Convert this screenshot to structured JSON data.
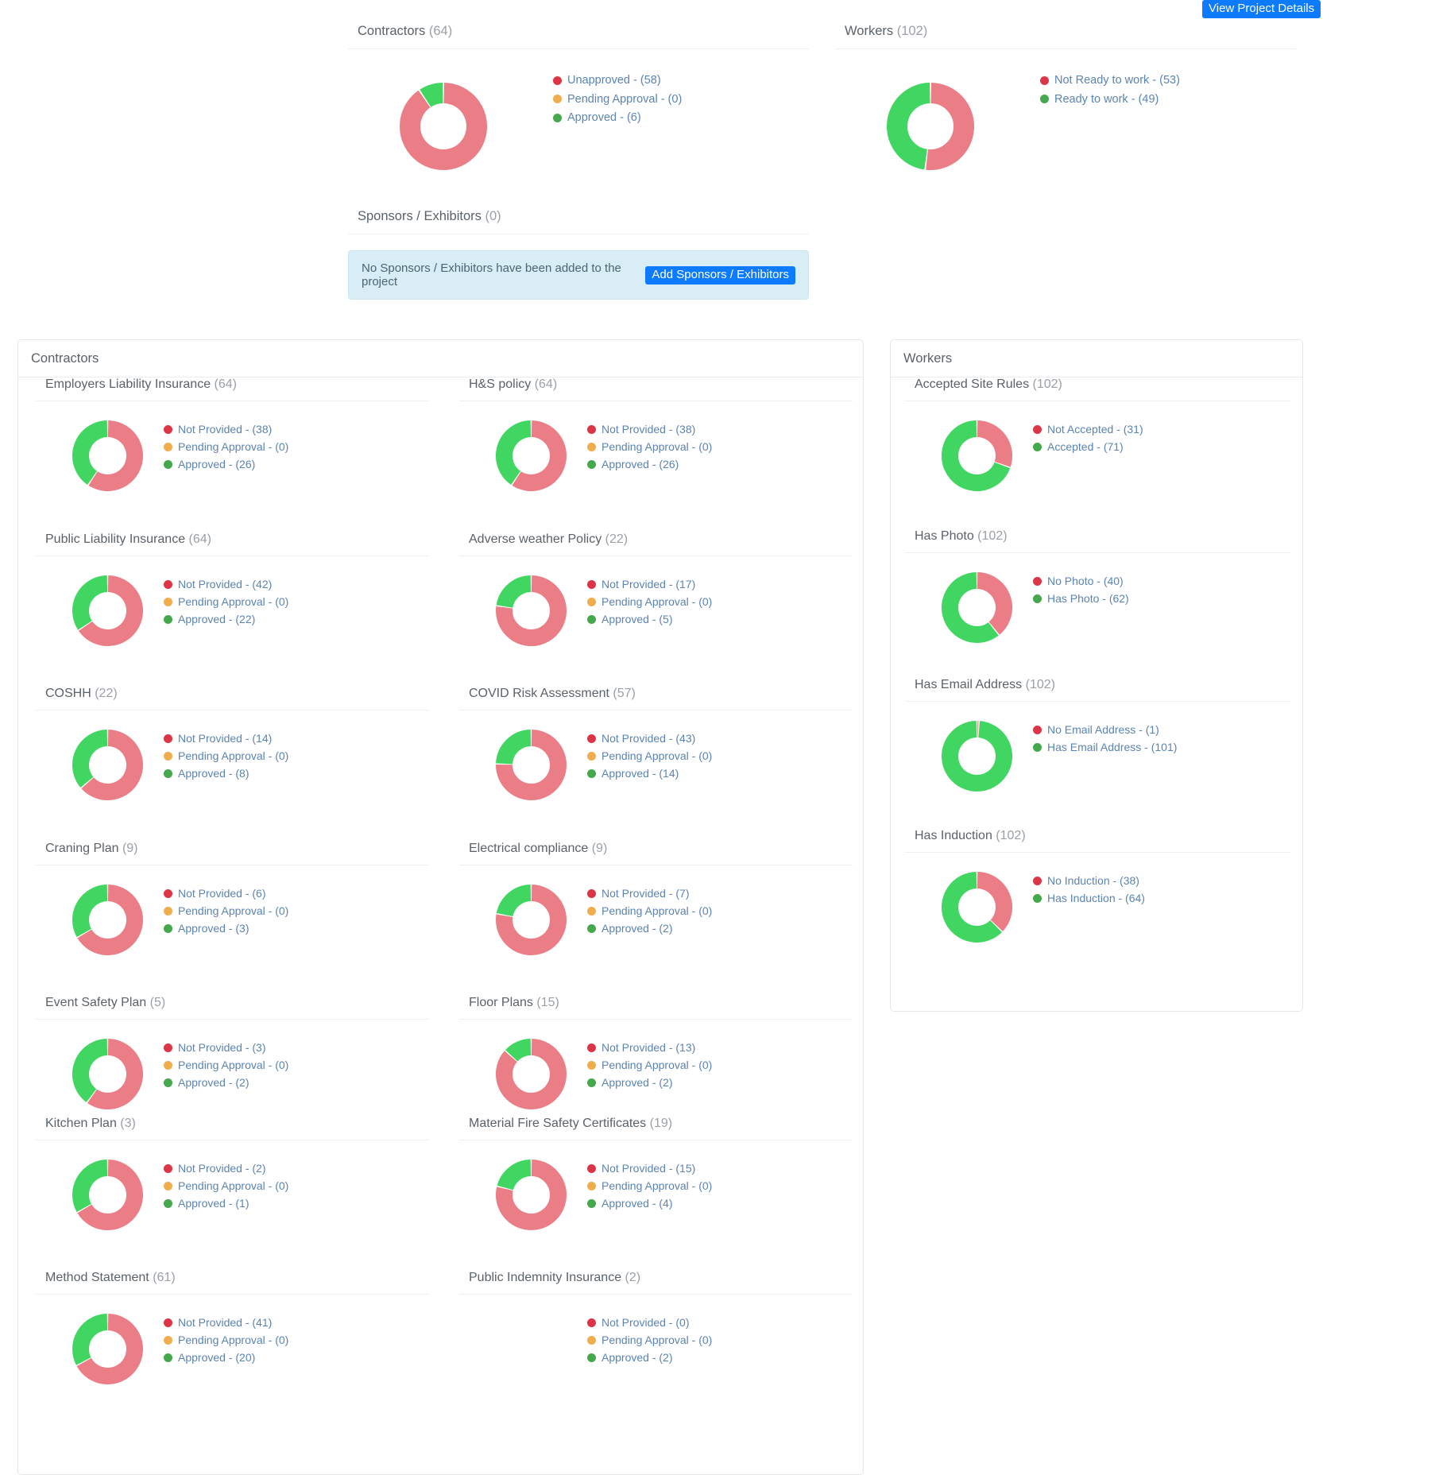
{
  "topbar": {
    "view_project_details": "View Project Details"
  },
  "colors": {
    "donut_red": "#ea7d86",
    "donut_green": "#41d661",
    "legend_red": "#dc3545",
    "legend_orange": "#f0ad4e",
    "legend_green": "#46a84c",
    "legend_text": "#5b84b1",
    "accent_blue": "#0d7bff",
    "alert_bg": "#d9edf7"
  },
  "summary": {
    "contractors": {
      "title": "Contractors",
      "count": "(64)",
      "legend": [
        {
          "label": "Unapproved - (58)",
          "color_key": "legend_red",
          "value": 58
        },
        {
          "label": "Pending Approval - (0)",
          "color_key": "legend_orange",
          "value": 0
        },
        {
          "label": "Approved - (6)",
          "color_key": "legend_green",
          "value": 6
        }
      ]
    },
    "workers": {
      "title": "Workers",
      "count": "(102)",
      "legend": [
        {
          "label": "Not Ready to work - (53)",
          "color_key": "legend_red",
          "value": 53
        },
        {
          "label": "Ready to work - (49)",
          "color_key": "legend_green",
          "value": 49
        }
      ]
    },
    "sponsors": {
      "title": "Sponsors / Exhibitors",
      "count": "(0)",
      "empty_message": "No Sponsors / Exhibitors have been added to the project",
      "add_button": "Add Sponsors / Exhibitors"
    }
  },
  "contractors_panel": {
    "title": "Contractors",
    "metrics": [
      {
        "title": "Employers Liability Insurance",
        "count": "(64)",
        "legend": [
          {
            "label": "Not Provided - (38)",
            "color_key": "legend_red",
            "value": 38
          },
          {
            "label": "Pending Approval - (0)",
            "color_key": "legend_orange",
            "value": 0
          },
          {
            "label": "Approved - (26)",
            "color_key": "legend_green",
            "value": 26
          }
        ]
      },
      {
        "title": "H&S policy",
        "count": "(64)",
        "legend": [
          {
            "label": "Not Provided - (38)",
            "color_key": "legend_red",
            "value": 38
          },
          {
            "label": "Pending Approval - (0)",
            "color_key": "legend_orange",
            "value": 0
          },
          {
            "label": "Approved - (26)",
            "color_key": "legend_green",
            "value": 26
          }
        ]
      },
      {
        "title": "Public Liability Insurance",
        "count": "(64)",
        "legend": [
          {
            "label": "Not Provided - (42)",
            "color_key": "legend_red",
            "value": 42
          },
          {
            "label": "Pending Approval - (0)",
            "color_key": "legend_orange",
            "value": 0
          },
          {
            "label": "Approved - (22)",
            "color_key": "legend_green",
            "value": 22
          }
        ]
      },
      {
        "title": "Adverse weather Policy",
        "count": "(22)",
        "legend": [
          {
            "label": "Not Provided - (17)",
            "color_key": "legend_red",
            "value": 17
          },
          {
            "label": "Pending Approval - (0)",
            "color_key": "legend_orange",
            "value": 0
          },
          {
            "label": "Approved - (5)",
            "color_key": "legend_green",
            "value": 5
          }
        ]
      },
      {
        "title": "COSHH",
        "count": "(22)",
        "legend": [
          {
            "label": "Not Provided - (14)",
            "color_key": "legend_red",
            "value": 14
          },
          {
            "label": "Pending Approval - (0)",
            "color_key": "legend_orange",
            "value": 0
          },
          {
            "label": "Approved - (8)",
            "color_key": "legend_green",
            "value": 8
          }
        ]
      },
      {
        "title": "COVID Risk Assessment",
        "count": "(57)",
        "legend": [
          {
            "label": "Not Provided - (43)",
            "color_key": "legend_red",
            "value": 43
          },
          {
            "label": "Pending Approval - (0)",
            "color_key": "legend_orange",
            "value": 0
          },
          {
            "label": "Approved - (14)",
            "color_key": "legend_green",
            "value": 14
          }
        ]
      },
      {
        "title": "Craning Plan",
        "count": "(9)",
        "legend": [
          {
            "label": "Not Provided - (6)",
            "color_key": "legend_red",
            "value": 6
          },
          {
            "label": "Pending Approval - (0)",
            "color_key": "legend_orange",
            "value": 0
          },
          {
            "label": "Approved - (3)",
            "color_key": "legend_green",
            "value": 3
          }
        ]
      },
      {
        "title": "Electrical compliance",
        "count": "(9)",
        "legend": [
          {
            "label": "Not Provided - (7)",
            "color_key": "legend_red",
            "value": 7
          },
          {
            "label": "Pending Approval - (0)",
            "color_key": "legend_orange",
            "value": 0
          },
          {
            "label": "Approved - (2)",
            "color_key": "legend_green",
            "value": 2
          }
        ]
      },
      {
        "title": "Event Safety Plan",
        "count": "(5)",
        "legend": [
          {
            "label": "Not Provided - (3)",
            "color_key": "legend_red",
            "value": 3
          },
          {
            "label": "Pending Approval - (0)",
            "color_key": "legend_orange",
            "value": 0
          },
          {
            "label": "Approved - (2)",
            "color_key": "legend_green",
            "value": 2
          }
        ]
      },
      {
        "title": "Floor Plans",
        "count": "(15)",
        "legend": [
          {
            "label": "Not Provided - (13)",
            "color_key": "legend_red",
            "value": 13
          },
          {
            "label": "Pending Approval - (0)",
            "color_key": "legend_orange",
            "value": 0
          },
          {
            "label": "Approved - (2)",
            "color_key": "legend_green",
            "value": 2
          }
        ]
      },
      {
        "title": "Kitchen Plan",
        "count": "(3)",
        "legend": [
          {
            "label": "Not Provided - (2)",
            "color_key": "legend_red",
            "value": 2
          },
          {
            "label": "Pending Approval - (0)",
            "color_key": "legend_orange",
            "value": 0
          },
          {
            "label": "Approved - (1)",
            "color_key": "legend_green",
            "value": 1
          }
        ]
      },
      {
        "title": "Material Fire Safety Certificates",
        "count": "(19)",
        "legend": [
          {
            "label": "Not Provided - (15)",
            "color_key": "legend_red",
            "value": 15
          },
          {
            "label": "Pending Approval - (0)",
            "color_key": "legend_orange",
            "value": 0
          },
          {
            "label": "Approved - (4)",
            "color_key": "legend_green",
            "value": 4
          }
        ]
      },
      {
        "title": "Method Statement",
        "count": "(61)",
        "legend": [
          {
            "label": "Not Provided - (41)",
            "color_key": "legend_red",
            "value": 41
          },
          {
            "label": "Pending Approval - (0)",
            "color_key": "legend_orange",
            "value": 0
          },
          {
            "label": "Approved - (20)",
            "color_key": "legend_green",
            "value": 20
          }
        ]
      },
      {
        "title": "Public Indemnity Insurance",
        "count": "(2)",
        "legend": [
          {
            "label": "Not Provided - (0)",
            "color_key": "legend_red",
            "value": 0
          },
          {
            "label": "Pending Approval - (0)",
            "color_key": "legend_orange",
            "value": 0
          },
          {
            "label": "Approved - (2)",
            "color_key": "legend_green",
            "value": 2
          }
        ]
      }
    ]
  },
  "workers_panel": {
    "title": "Workers",
    "metrics": [
      {
        "title": "Accepted Site Rules",
        "count": "(102)",
        "legend": [
          {
            "label": "Not Accepted - (31)",
            "color_key": "legend_red",
            "value": 31
          },
          {
            "label": "Accepted - (71)",
            "color_key": "legend_green",
            "value": 71
          }
        ]
      },
      {
        "title": "Has Photo",
        "count": "(102)",
        "legend": [
          {
            "label": "No Photo - (40)",
            "color_key": "legend_red",
            "value": 40
          },
          {
            "label": "Has Photo - (62)",
            "color_key": "legend_green",
            "value": 62
          }
        ]
      },
      {
        "title": "Has Email Address",
        "count": "(102)",
        "legend": [
          {
            "label": "No Email Address - (1)",
            "color_key": "legend_red",
            "value": 1
          },
          {
            "label": "Has Email Address - (101)",
            "color_key": "legend_green",
            "value": 101
          }
        ]
      },
      {
        "title": "Has Induction",
        "count": "(102)",
        "legend": [
          {
            "label": "No Induction - (38)",
            "color_key": "legend_red",
            "value": 38
          },
          {
            "label": "Has Induction - (64)",
            "color_key": "legend_green",
            "value": 64
          }
        ]
      }
    ]
  },
  "chart_data": {
    "type": "pie",
    "title": "Project compliance donut charts",
    "donut": true,
    "charts": [
      {
        "id": "summary-contractors",
        "title": "Contractors (64)",
        "categories": [
          "Unapproved",
          "Pending Approval",
          "Approved"
        ],
        "values": [
          58,
          0,
          6
        ],
        "total": 64,
        "colors": [
          "#ea7d86",
          "#f0ad4e",
          "#41d661"
        ]
      },
      {
        "id": "summary-workers",
        "title": "Workers (102)",
        "categories": [
          "Not Ready to work",
          "Ready to work"
        ],
        "values": [
          53,
          49
        ],
        "total": 102,
        "colors": [
          "#ea7d86",
          "#41d661"
        ]
      },
      {
        "id": "employers-liability-insurance",
        "title": "Employers Liability Insurance (64)",
        "categories": [
          "Not Provided",
          "Pending Approval",
          "Approved"
        ],
        "values": [
          38,
          0,
          26
        ],
        "total": 64,
        "colors": [
          "#ea7d86",
          "#f0ad4e",
          "#41d661"
        ]
      },
      {
        "id": "hs-policy",
        "title": "H&S policy (64)",
        "categories": [
          "Not Provided",
          "Pending Approval",
          "Approved"
        ],
        "values": [
          38,
          0,
          26
        ],
        "total": 64,
        "colors": [
          "#ea7d86",
          "#f0ad4e",
          "#41d661"
        ]
      },
      {
        "id": "public-liability-insurance",
        "title": "Public Liability Insurance (64)",
        "categories": [
          "Not Provided",
          "Pending Approval",
          "Approved"
        ],
        "values": [
          42,
          0,
          22
        ],
        "total": 64,
        "colors": [
          "#ea7d86",
          "#f0ad4e",
          "#41d661"
        ]
      },
      {
        "id": "adverse-weather-policy",
        "title": "Adverse weather Policy (22)",
        "categories": [
          "Not Provided",
          "Pending Approval",
          "Approved"
        ],
        "values": [
          17,
          0,
          5
        ],
        "total": 22,
        "colors": [
          "#ea7d86",
          "#f0ad4e",
          "#41d661"
        ]
      },
      {
        "id": "coshh",
        "title": "COSHH (22)",
        "categories": [
          "Not Provided",
          "Pending Approval",
          "Approved"
        ],
        "values": [
          14,
          0,
          8
        ],
        "total": 22,
        "colors": [
          "#ea7d86",
          "#f0ad4e",
          "#41d661"
        ]
      },
      {
        "id": "covid-risk-assessment",
        "title": "COVID Risk Assessment (57)",
        "categories": [
          "Not Provided",
          "Pending Approval",
          "Approved"
        ],
        "values": [
          43,
          0,
          14
        ],
        "total": 57,
        "colors": [
          "#ea7d86",
          "#f0ad4e",
          "#41d661"
        ]
      },
      {
        "id": "craning-plan",
        "title": "Craning Plan (9)",
        "categories": [
          "Not Provided",
          "Pending Approval",
          "Approved"
        ],
        "values": [
          6,
          0,
          3
        ],
        "total": 9,
        "colors": [
          "#ea7d86",
          "#f0ad4e",
          "#41d661"
        ]
      },
      {
        "id": "electrical-compliance",
        "title": "Electrical compliance (9)",
        "categories": [
          "Not Provided",
          "Pending Approval",
          "Approved"
        ],
        "values": [
          7,
          0,
          2
        ],
        "total": 9,
        "colors": [
          "#ea7d86",
          "#f0ad4e",
          "#41d661"
        ]
      },
      {
        "id": "event-safety-plan",
        "title": "Event Safety Plan (5)",
        "categories": [
          "Not Provided",
          "Pending Approval",
          "Approved"
        ],
        "values": [
          3,
          0,
          2
        ],
        "total": 5,
        "colors": [
          "#ea7d86",
          "#f0ad4e",
          "#41d661"
        ]
      },
      {
        "id": "floor-plans",
        "title": "Floor Plans (15)",
        "categories": [
          "Not Provided",
          "Pending Approval",
          "Approved"
        ],
        "values": [
          13,
          0,
          2
        ],
        "total": 15,
        "colors": [
          "#ea7d86",
          "#f0ad4e",
          "#41d661"
        ]
      },
      {
        "id": "kitchen-plan",
        "title": "Kitchen Plan (3)",
        "categories": [
          "Not Provided",
          "Pending Approval",
          "Approved"
        ],
        "values": [
          2,
          0,
          1
        ],
        "total": 3,
        "colors": [
          "#ea7d86",
          "#f0ad4e",
          "#41d661"
        ]
      },
      {
        "id": "material-fire-safety-certificates",
        "title": "Material Fire Safety Certificates (19)",
        "categories": [
          "Not Provided",
          "Pending Approval",
          "Approved"
        ],
        "values": [
          15,
          0,
          4
        ],
        "total": 19,
        "colors": [
          "#ea7d86",
          "#f0ad4e",
          "#41d661"
        ]
      },
      {
        "id": "method-statement",
        "title": "Method Statement (61)",
        "categories": [
          "Not Provided",
          "Pending Approval",
          "Approved"
        ],
        "values": [
          41,
          0,
          20
        ],
        "total": 61,
        "colors": [
          "#ea7d86",
          "#f0ad4e",
          "#41d661"
        ]
      },
      {
        "id": "public-indemnity-insurance",
        "title": "Public Indemnity Insurance (2)",
        "categories": [
          "Not Provided",
          "Pending Approval",
          "Approved"
        ],
        "values": [
          0,
          0,
          2
        ],
        "total": 2,
        "colors": [
          "#ea7d86",
          "#f0ad4e",
          "#41d661"
        ]
      },
      {
        "id": "accepted-site-rules",
        "title": "Accepted Site Rules (102)",
        "categories": [
          "Not Accepted",
          "Accepted"
        ],
        "values": [
          31,
          71
        ],
        "total": 102,
        "colors": [
          "#ea7d86",
          "#41d661"
        ]
      },
      {
        "id": "has-photo",
        "title": "Has Photo (102)",
        "categories": [
          "No Photo",
          "Has Photo"
        ],
        "values": [
          40,
          62
        ],
        "total": 102,
        "colors": [
          "#ea7d86",
          "#41d661"
        ]
      },
      {
        "id": "has-email-address",
        "title": "Has Email Address (102)",
        "categories": [
          "No Email Address",
          "Has Email Address"
        ],
        "values": [
          1,
          101
        ],
        "total": 102,
        "colors": [
          "#ea7d86",
          "#41d661"
        ]
      },
      {
        "id": "has-induction",
        "title": "Has Induction (102)",
        "categories": [
          "No Induction",
          "Has Induction"
        ],
        "values": [
          38,
          64
        ],
        "total": 102,
        "colors": [
          "#ea7d86",
          "#41d661"
        ]
      }
    ]
  }
}
